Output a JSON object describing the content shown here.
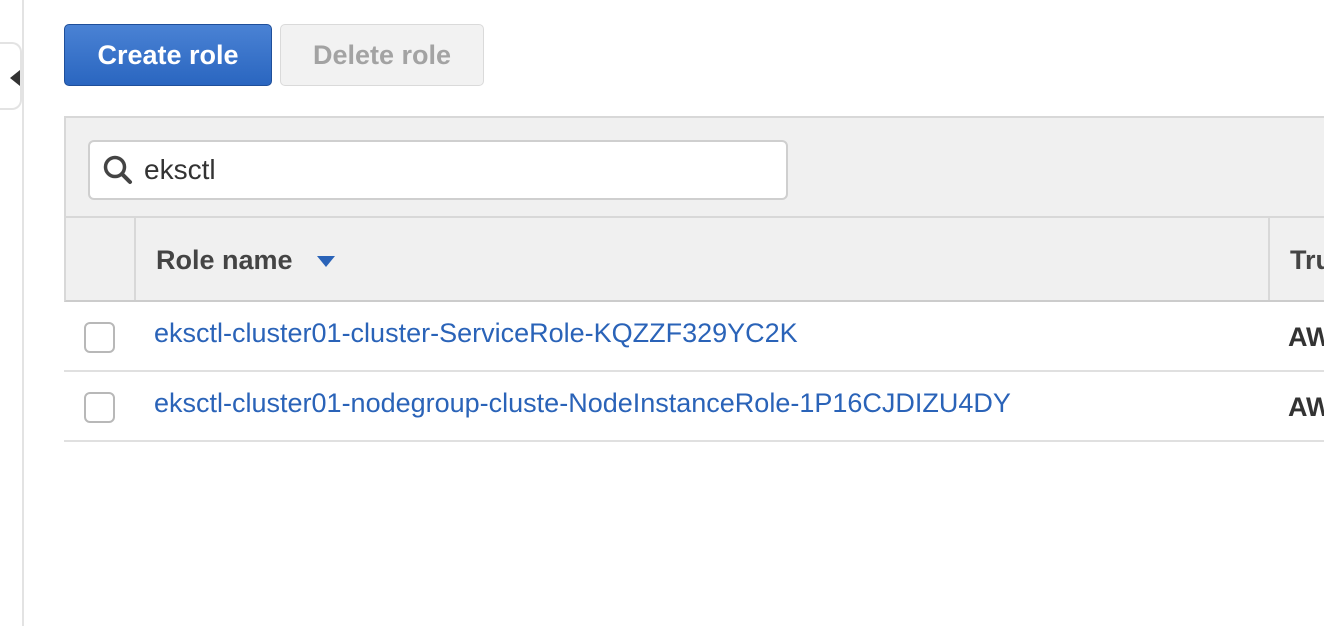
{
  "toolbar": {
    "create_label": "Create role",
    "delete_label": "Delete role"
  },
  "search": {
    "value": "eksctl",
    "placeholder": ""
  },
  "table": {
    "columns": {
      "role_name": "Role name",
      "trusted": "Tru"
    },
    "sort": "descending",
    "rows": [
      {
        "role_name": "eksctl-cluster01-cluster-ServiceRole-KQZZF329YC2K",
        "trusted": "AW"
      },
      {
        "role_name": "eksctl-cluster01-nodegroup-cluste-NodeInstanceRole-1P16CJDIZU4DY",
        "trusted": "AW"
      }
    ]
  },
  "icons": {
    "collapse": "caret-left-icon",
    "search": "search-icon",
    "sort": "sort-down-icon"
  },
  "colors": {
    "primary": "#2a66c0",
    "link": "#2a63b8"
  }
}
